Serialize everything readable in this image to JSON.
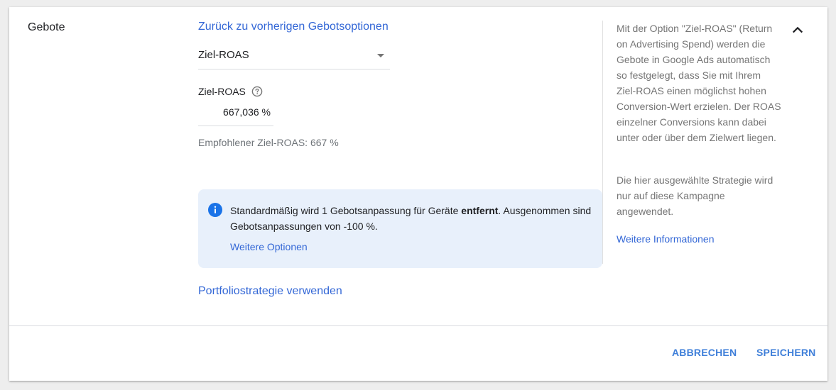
{
  "section": {
    "title": "Gebote"
  },
  "bidding": {
    "back_link": "Zurück zu vorherigen Gebotsoptionen",
    "strategy_selected": "Ziel-ROAS",
    "roas_label": "Ziel-ROAS",
    "roas_value": "667,036 %",
    "recommended": "Empfohlener Ziel-ROAS: 667 %",
    "portfolio_link": "Portfoliostrategie verwenden"
  },
  "info_box": {
    "text_before": "Standardmäßig wird 1 Gebotsanpassung für Geräte ",
    "text_bold": "entfernt",
    "text_after": ". Ausgenommen sind Gebotsanpassungen von -100 %.",
    "more_options": "Weitere Optionen"
  },
  "sidebar": {
    "paragraph1": "Mit der Option \"Ziel-ROAS\" (Return on Advertising Spend) werden die Gebote in Google Ads automatisch so festgelegt, dass Sie mit Ihrem Ziel-ROAS einen möglichst hohen Conversion-Wert erzielen. Der ROAS einzelner Conversions kann dabei unter oder über dem Zielwert liegen.",
    "paragraph2": "Die hier ausgewählte Strategie wird nur auf diese Kampagne angewendet.",
    "more_info": "Weitere Informationen"
  },
  "actions": {
    "cancel": "ABBRECHEN",
    "save": "SPEICHERN"
  },
  "icons": {
    "help": "help-circle-icon",
    "info": "info-icon",
    "collapse": "chevron-up-icon",
    "dropdown": "dropdown-arrow-icon"
  },
  "colors": {
    "link": "#3367d6",
    "button": "#3f7fd9",
    "info_background": "#e8f0fb",
    "info_icon": "#1a73e8",
    "secondary_text": "#757575"
  }
}
